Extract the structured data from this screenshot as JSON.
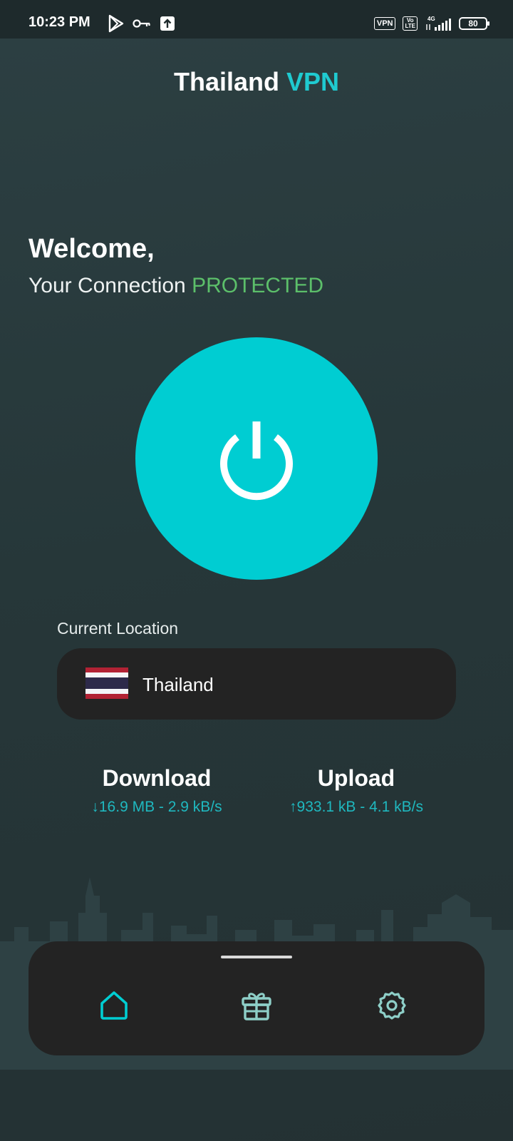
{
  "status_bar": {
    "time": "10:23 PM",
    "icons_left": [
      "play-store-icon",
      "vpn-key-icon",
      "upload-icon"
    ],
    "vpn_badge": "VPN",
    "volte_badge": "Vo LTE",
    "network": "4G",
    "battery": "80"
  },
  "header": {
    "title_main": "Thailand",
    "title_accent": "VPN"
  },
  "welcome": {
    "greeting": "Welcome,",
    "connection_prefix": "Your Connection",
    "connection_status": "PROTECTED"
  },
  "power_button": {
    "icon": "power-icon"
  },
  "location": {
    "label": "Current Location",
    "country": "Thailand",
    "flag_icon": "thailand-flag-icon"
  },
  "stats": {
    "download": {
      "label": "Download",
      "value": "↓16.9 MB - 2.9 kB/s"
    },
    "upload": {
      "label": "Upload",
      "value": "↑933.1 kB - 4.1 kB/s"
    }
  },
  "bottom_nav": {
    "items": [
      {
        "icon": "home-icon",
        "active": true
      },
      {
        "icon": "gift-icon",
        "active": false
      },
      {
        "icon": "settings-icon",
        "active": false
      }
    ]
  },
  "colors": {
    "accent": "#00CDD2",
    "protected": "#5CBF6A",
    "background": "#263537",
    "card": "#232323"
  }
}
